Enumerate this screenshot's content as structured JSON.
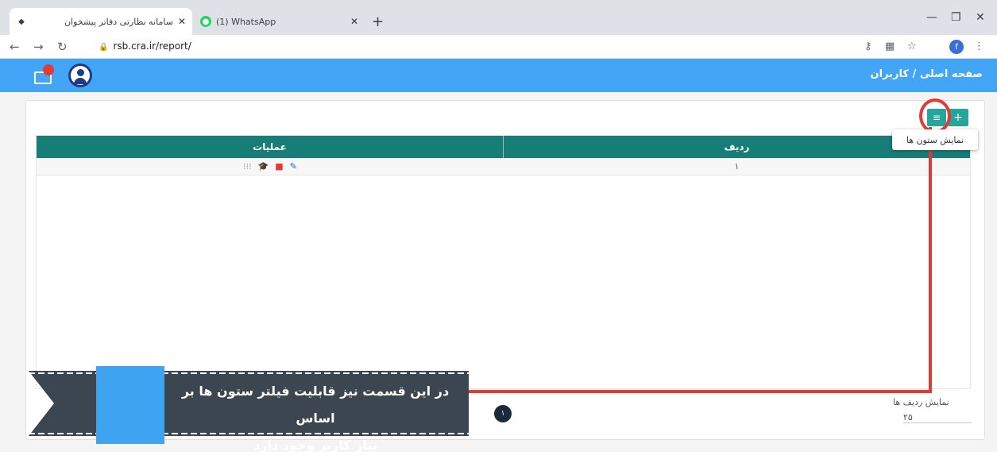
{
  "browser": {
    "tabs": [
      {
        "title": "سامانه نظارتی دفاتر پیشخوان",
        "favicon": "site-logo-icon"
      },
      {
        "title": "(1) WhatsApp",
        "favicon": "whatsapp-icon"
      }
    ],
    "url": "rsb.cra.ir/report/",
    "profile_initial": "f"
  },
  "header": {
    "breadcrumb_home": "صفحه اصلی",
    "breadcrumb_sep": " / ",
    "breadcrumb_current": "کاربران"
  },
  "toolbar": {
    "add_label": "+",
    "columns_label": "≡",
    "tooltip": "نمایش ستون ها"
  },
  "table": {
    "headers": {
      "row": "ردیف",
      "ops": "عملیات"
    },
    "rows": [
      {
        "row": "۱"
      }
    ]
  },
  "footer": {
    "rows_label": "نمایش ردیف ها",
    "rows_value": "۲۵",
    "page": "۱"
  },
  "callout": {
    "line1": "در این قسمت نیز قابلیت فیلتر ستون ها بر اساس",
    "line2": "نیاز کاربر وجود دارد"
  },
  "colors": {
    "header": "#42a5f5",
    "table_head": "#177e77",
    "accent": "#26a69a",
    "highlight": "#e53935",
    "banner": "#3b4650"
  }
}
